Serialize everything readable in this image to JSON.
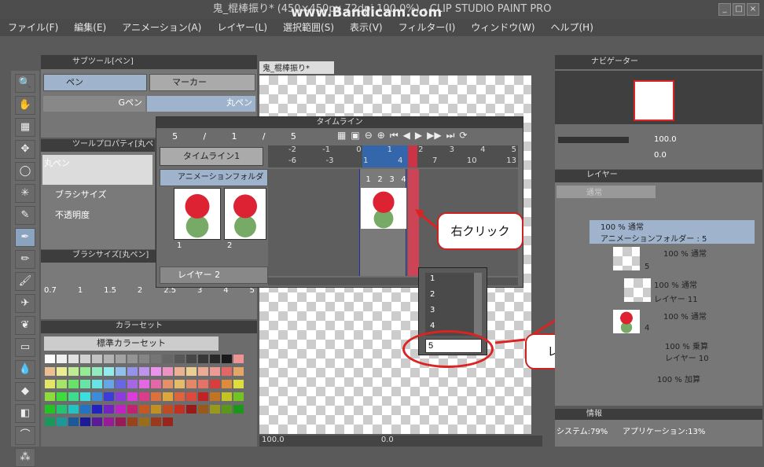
{
  "window": {
    "title": "鬼_棍棒振り* (450×450px 72dpi 100.0%) - CLIP STUDIO PAINT PRO",
    "watermark": "www.Bandicam.com",
    "min_label": "_",
    "max_label": "□",
    "close_label": "×"
  },
  "menu": [
    "ファイル(F)",
    "編集(E)",
    "アニメーション(A)",
    "レイヤー(L)",
    "選択範囲(S)",
    "表示(V)",
    "フィルター(I)",
    "ウィンドウ(W)",
    "ヘルプ(H)"
  ],
  "subtool": {
    "header": "サブツール[ペン]",
    "tab_pen": "ペン",
    "tab_marker": "マーカー",
    "brush_g": "Gペン",
    "brush_maru": "丸ペン"
  },
  "toolprop": {
    "header": "ツールプロパティ[丸ペ",
    "name": "丸ペン",
    "brush_size": "ブラシサイズ",
    "opacity": "不透明度"
  },
  "brushsize": {
    "header": "ブラシサイズ[丸ペン]",
    "sizes": [
      "0.7",
      "1",
      "1.5",
      "2",
      "2.5",
      "3",
      "4",
      "5"
    ]
  },
  "colorset": {
    "header": "カラーセット",
    "name": "標準カラーセット"
  },
  "canvas": {
    "tab": "鬼_棍棒振り*",
    "zoom": "100.0",
    "rotation": "0.0"
  },
  "timeline": {
    "header": "タイムライン",
    "frame_current": "5",
    "frame_sep1": "/",
    "frame_start": "1",
    "frame_sep2": "/",
    "frame_end": "5",
    "name": "タイムライン1",
    "folder_layer": "アニメーションフォルダー",
    "layer2": "レイヤー 2",
    "ruler_top": [
      "-2",
      "-1",
      "0",
      "1",
      "2",
      "3",
      "4",
      "5"
    ],
    "ruler_bottom": [
      "-6",
      "-3",
      "1",
      "4",
      "7",
      "10",
      "13"
    ],
    "cel_numbers": [
      "1",
      "2",
      "3",
      "4"
    ],
    "thumb_labels": [
      "1",
      "2"
    ]
  },
  "popup": {
    "items": [
      "1",
      "2",
      "3",
      "4"
    ],
    "input_value": "5"
  },
  "callouts": {
    "right_click": "右クリック",
    "enter_name": "レイヤー名を入力"
  },
  "navigator": {
    "header": "ナビゲーター",
    "zoom": "100.0",
    "angle": "0.0"
  },
  "layers": {
    "header": "レイヤー",
    "blend": "通常",
    "rows": [
      {
        "pct": "100 %",
        "mode": "通常",
        "name": "アニメーションフォルダー : 5"
      },
      {
        "pct": "100 %",
        "mode": "通常",
        "name": "5"
      },
      {
        "pct": "100 %",
        "mode": "通常",
        "name": "レイヤー 11"
      },
      {
        "pct": "100 %",
        "mode": "通常",
        "name": "4"
      },
      {
        "pct": "100 %",
        "mode": "乗算",
        "name": "レイヤー 10"
      },
      {
        "pct": "100 %",
        "mode": "加算",
        "name": ""
      }
    ]
  },
  "info": {
    "header": "情報",
    "system": "システム:79%",
    "app": "アプリケーション:13%"
  },
  "colors": {
    "accent_red": "#d22222",
    "panel_bg": "#6f6f6f"
  }
}
